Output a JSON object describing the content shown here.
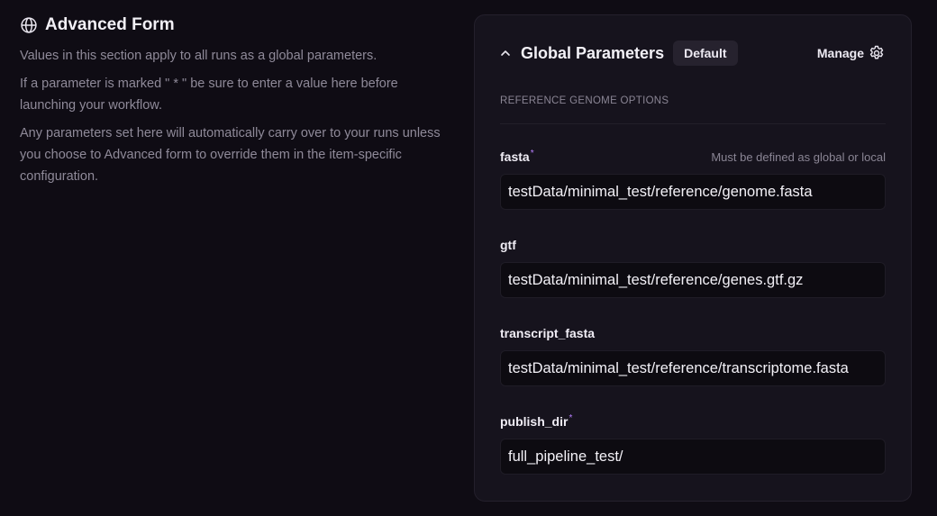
{
  "left": {
    "title": "Advanced Form",
    "icon": "globe-icon",
    "paragraphs": [
      "Values in this section apply to all runs as a global parameters.",
      "If a parameter is marked \" * \" be sure to enter a value here before launching your workflow.",
      "Any parameters set here will automatically carry over to your runs unless you choose to Advanced form to override them in the item-specific configuration."
    ]
  },
  "panel": {
    "title": "Global Parameters",
    "badge": "Default",
    "manage_label": "Manage",
    "collapse_icon": "chevron-up-icon",
    "manage_icon": "gear-icon",
    "section_label": "REFERENCE GENOME OPTIONS",
    "fields": [
      {
        "label": "fasta",
        "required": "*",
        "hint": "Must be defined as global or local",
        "value": "testData/minimal_test/reference/genome.fasta"
      },
      {
        "label": "gtf",
        "value": "testData/minimal_test/reference/genes.gtf.gz"
      },
      {
        "label": "transcript_fasta",
        "value": "testData/minimal_test/reference/transcriptome.fasta"
      },
      {
        "label": "publish_dir",
        "required": "*",
        "value": "full_pipeline_test/"
      }
    ]
  },
  "colors": {
    "background": "#0f0c14",
    "panel": "#16131d",
    "required_marker": "#b77fff"
  }
}
